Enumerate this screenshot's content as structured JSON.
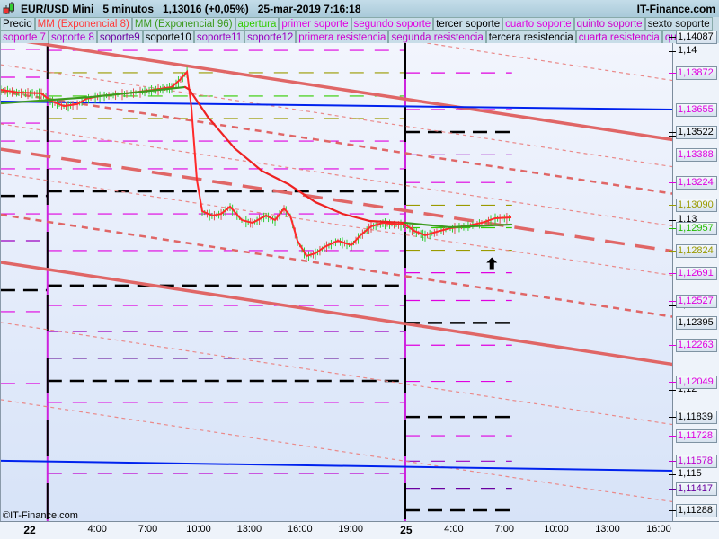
{
  "header": {
    "title": "EUR/USD Mini   5 minutos   1,13016 (+0,05%)   25-mar-2019 7:16:18",
    "brand": "IT-Finance.com",
    "copyright": "©IT-Finance.com"
  },
  "legend_row1": [
    {
      "label": "Precio",
      "color": "#000000"
    },
    {
      "label": "MM (Exponencial 8)",
      "color": "#ff3b3b"
    },
    {
      "label": "MM (Exponencial 96)",
      "color": "#3c9a1e"
    },
    {
      "label": "apertura",
      "color": "#33cc00"
    },
    {
      "label": "primer soporte",
      "color": "#e000e0"
    },
    {
      "label": "segundo soporte",
      "color": "#e000e0"
    },
    {
      "label": "tercer soporte",
      "color": "#000000"
    },
    {
      "label": "cuarto soporte",
      "color": "#e000e0"
    },
    {
      "label": "quinto soporte",
      "color": "#cc00cc"
    },
    {
      "label": "sexto soporte",
      "color": "#111111"
    }
  ],
  "legend_row2": [
    {
      "label": "soporte 7",
      "color": "#cc00cc"
    },
    {
      "label": "soporte 8",
      "color": "#b000d0"
    },
    {
      "label": "soporte9",
      "color": "#6a00a0"
    },
    {
      "label": "soporte10",
      "color": "#000000"
    },
    {
      "label": "soporte11",
      "color": "#9a00c0"
    },
    {
      "label": "soporte12",
      "color": "#9a00c0"
    },
    {
      "label": "primera resistencia",
      "color": "#d000d0"
    },
    {
      "label": "segunda resistencia",
      "color": "#c000c8"
    },
    {
      "label": "tercera resistencia",
      "color": "#000000"
    },
    {
      "label": "cuarta resistencia",
      "color": "#d000d0"
    },
    {
      "label": "quinta res",
      "color": "#c000c8"
    }
  ],
  "chart_data": {
    "type": "line",
    "title": "EUR/USD Mini 5 minutos",
    "ylim": [
      1.11085,
      1.14135
    ],
    "xlim_hours": [
      -1.76,
      38.03
    ],
    "x_ticks": [
      {
        "t": 0,
        "label": "22",
        "day": true
      },
      {
        "t": 4,
        "label": "4:00"
      },
      {
        "t": 7,
        "label": "7:00"
      },
      {
        "t": 10,
        "label": "10:00"
      },
      {
        "t": 13,
        "label": "13:00"
      },
      {
        "t": 16,
        "label": "16:00"
      },
      {
        "t": 19,
        "label": "19:00"
      },
      {
        "t": 22.28,
        "label": "25",
        "day": true
      },
      {
        "t": 25.1,
        "label": "4:00"
      },
      {
        "t": 28.1,
        "label": "7:00"
      },
      {
        "t": 31.17,
        "label": "10:00"
      },
      {
        "t": 34.2,
        "label": "13:00"
      },
      {
        "t": 37.23,
        "label": "16:00"
      }
    ],
    "y_plain_ticks": [
      {
        "v": 1.14,
        "label": "1,14"
      },
      {
        "v": 1.135,
        "label": "1,135"
      },
      {
        "v": 1.13,
        "label": "1,13"
      },
      {
        "v": 1.125,
        "label": "1,125"
      },
      {
        "v": 1.12,
        "label": "1,12"
      },
      {
        "v": 1.115,
        "label": "1,115"
      }
    ],
    "y_labels": [
      {
        "v": 1.14087,
        "label": "1,14087",
        "color": "#000000"
      },
      {
        "v": 1.13872,
        "label": "1,13872",
        "color": "#e000e0"
      },
      {
        "v": 1.13655,
        "label": "1,13655",
        "color": "#e000e0"
      },
      {
        "v": 1.13522,
        "label": "1,13522",
        "color": "#000000"
      },
      {
        "v": 1.13388,
        "label": "1,13388",
        "color": "#e000e0"
      },
      {
        "v": 1.13224,
        "label": "1,13224",
        "color": "#e000e0"
      },
      {
        "v": 1.1309,
        "label": "1,13090",
        "color": "#9a9a00"
      },
      {
        "v": 1.12957,
        "label": "1,12957",
        "color": "#22bb00"
      },
      {
        "v": 1.12824,
        "label": "1,12824",
        "color": "#9a9a00"
      },
      {
        "v": 1.12691,
        "label": "1,12691",
        "color": "#e000e0"
      },
      {
        "v": 1.12527,
        "label": "1,12527",
        "color": "#e000e0"
      },
      {
        "v": 1.12395,
        "label": "1,12395",
        "color": "#000000"
      },
      {
        "v": 1.12263,
        "label": "1,12263",
        "color": "#e000e0"
      },
      {
        "v": 1.12049,
        "label": "1,12049",
        "color": "#e000e0"
      },
      {
        "v": 1.11839,
        "label": "1,11839",
        "color": "#000000"
      },
      {
        "v": 1.11728,
        "label": "1,11728",
        "color": "#e000e0"
      },
      {
        "v": 1.11578,
        "label": "1,11578",
        "color": "#c000d0"
      },
      {
        "v": 1.11417,
        "label": "1,11417",
        "color": "#6a00a0"
      },
      {
        "v": 1.11288,
        "label": "1,11288",
        "color": "#000000"
      }
    ],
    "day_separators": [
      1.0,
      22.18
    ],
    "level_sets": [
      {
        "t0": -1.76,
        "t1": 1.0,
        "levels": [
          {
            "v": 1.14011,
            "c": "#e000e0"
          },
          {
            "v": 1.13846,
            "c": "#e000e0"
          },
          {
            "v": 1.13575,
            "c": "#e000e0"
          },
          {
            "v": 1.13469,
            "c": "#e000e0"
          },
          {
            "v": 1.13305,
            "c": "#e000e0"
          },
          {
            "v": 1.13145,
            "c": "#000000"
          },
          {
            "v": 1.13039,
            "c": "#e000e0"
          },
          {
            "v": 1.1288,
            "c": "#9a00c0"
          },
          {
            "v": 1.12588,
            "c": "#000000"
          },
          {
            "v": 1.12461,
            "c": "#e000e0"
          },
          {
            "v": 1.12036,
            "c": "#e000e0"
          }
        ]
      },
      {
        "t0": 1.0,
        "t1": 22.18,
        "levels": [
          {
            "v": 1.14005,
            "c": "#e000e0"
          },
          {
            "v": 1.13873,
            "c": "#9a9a00"
          },
          {
            "v": 1.13735,
            "c": "#33cc00"
          },
          {
            "v": 1.13602,
            "c": "#9a9a00"
          },
          {
            "v": 1.13469,
            "c": "#e000e0"
          },
          {
            "v": 1.13305,
            "c": "#e000e0"
          },
          {
            "v": 1.13172,
            "c": "#000000"
          },
          {
            "v": 1.13039,
            "c": "#e000e0"
          },
          {
            "v": 1.12822,
            "c": "#e000e0"
          },
          {
            "v": 1.12615,
            "c": "#000000"
          },
          {
            "v": 1.12498,
            "c": "#e000e0"
          },
          {
            "v": 1.12344,
            "c": "#9a00c0"
          },
          {
            "v": 1.12185,
            "c": "#5a0090"
          },
          {
            "v": 1.12052,
            "c": "#000000"
          },
          {
            "v": 1.11925,
            "c": "#e000e0"
          },
          {
            "v": 1.11505,
            "c": "#c000d0"
          }
        ]
      },
      {
        "t0": 22.18,
        "t1": 28.5,
        "levels": [
          {
            "v": 1.13872,
            "c": "#e000e0"
          },
          {
            "v": 1.13655,
            "c": "#e000e0"
          },
          {
            "v": 1.13522,
            "c": "#000000"
          },
          {
            "v": 1.13388,
            "c": "#9a00c0"
          },
          {
            "v": 1.13224,
            "c": "#e000e0"
          },
          {
            "v": 1.1309,
            "c": "#9a9a00"
          },
          {
            "v": 1.12957,
            "c": "#33cc00"
          },
          {
            "v": 1.12824,
            "c": "#9a9a00"
          },
          {
            "v": 1.12691,
            "c": "#e000e0"
          },
          {
            "v": 1.12527,
            "c": "#e000e0"
          },
          {
            "v": 1.12395,
            "c": "#000000"
          },
          {
            "v": 1.12263,
            "c": "#e000e0"
          },
          {
            "v": 1.12049,
            "c": "#e000e0"
          },
          {
            "v": 1.11839,
            "c": "#000000"
          },
          {
            "v": 1.11728,
            "c": "#e000e0"
          },
          {
            "v": 1.11578,
            "c": "#9a00c0"
          },
          {
            "v": 1.11417,
            "c": "#6a00a0"
          },
          {
            "v": 1.11288,
            "c": "#000000"
          }
        ]
      }
    ],
    "trendlines": [
      {
        "name": "channel-top",
        "style": "thick",
        "p": [
          -1.76,
          1.1408,
          38.14,
          1.13475
        ]
      },
      {
        "name": "thin-a",
        "style": "thin",
        "p": [
          -1.76,
          1.1443,
          38.14,
          1.13825
        ]
      },
      {
        "name": "thin-b",
        "style": "thin",
        "p": [
          -1.76,
          1.1392,
          38.14,
          1.13315
        ]
      },
      {
        "name": "medium-c",
        "style": "medium",
        "p": [
          -1.76,
          1.13761,
          38.14,
          1.13156
        ]
      },
      {
        "name": "thin-d",
        "style": "thin",
        "p": [
          -1.76,
          1.1357,
          38.14,
          1.12965
        ]
      },
      {
        "name": "channel-mid",
        "style": "thickdash",
        "p": [
          -1.76,
          1.13421,
          38.14,
          1.12816
        ]
      },
      {
        "name": "thin-f",
        "style": "thin",
        "p": [
          -1.76,
          1.13278,
          38.14,
          1.12673
        ]
      },
      {
        "name": "medium-g",
        "style": "medium",
        "p": [
          -1.76,
          1.13034,
          38.14,
          1.12429
        ]
      },
      {
        "name": "channel-bottom",
        "style": "thick",
        "p": [
          -1.76,
          1.12753,
          38.14,
          1.12148
        ]
      },
      {
        "name": "thin-i",
        "style": "thin",
        "p": [
          -1.76,
          1.12397,
          38.14,
          1.11792
        ]
      },
      {
        "name": "thin-j",
        "style": "thin",
        "p": [
          -1.76,
          1.11941,
          38.14,
          1.11336
        ]
      },
      {
        "name": "blue-upper",
        "style": "blue",
        "p": [
          -1.76,
          1.13703,
          38.14,
          1.13655
        ]
      },
      {
        "name": "blue-lower",
        "style": "blue",
        "p": [
          -1.76,
          1.1158,
          38.14,
          1.11521
        ]
      }
    ],
    "price": [
      [
        -1.76,
        1.13772
      ],
      [
        -0.69,
        1.13756
      ],
      [
        0.64,
        1.13751
      ],
      [
        1.17,
        1.13708
      ],
      [
        1.97,
        1.13676
      ],
      [
        2.77,
        1.13687
      ],
      [
        3.3,
        1.13719
      ],
      [
        4.1,
        1.13735
      ],
      [
        5.69,
        1.13751
      ],
      [
        7.29,
        1.13772
      ],
      [
        8.35,
        1.13788
      ],
      [
        8.88,
        1.13835
      ],
      [
        9.26,
        1.13878
      ],
      [
        9.52,
        1.13666
      ],
      [
        9.84,
        1.13241
      ],
      [
        10.16,
        1.13055
      ],
      [
        10.74,
        1.13029
      ],
      [
        11.28,
        1.13039
      ],
      [
        11.81,
        1.13082
      ],
      [
        12.5,
        1.13002
      ],
      [
        13.14,
        1.12986
      ],
      [
        13.94,
        1.13029
      ],
      [
        14.47,
        1.13002
      ],
      [
        15.0,
        1.13071
      ],
      [
        15.37,
        1.13029
      ],
      [
        15.8,
        1.1288
      ],
      [
        16.33,
        1.1279
      ],
      [
        16.86,
        1.12806
      ],
      [
        17.39,
        1.12843
      ],
      [
        18.19,
        1.1288
      ],
      [
        18.99,
        1.12854
      ],
      [
        19.52,
        1.12912
      ],
      [
        20.16,
        1.12965
      ],
      [
        20.85,
        1.12986
      ],
      [
        21.65,
        1.12976
      ],
      [
        22.18,
        1.12976
      ],
      [
        22.71,
        1.12938
      ],
      [
        23.35,
        1.12912
      ],
      [
        24.04,
        1.12933
      ],
      [
        24.84,
        1.12954
      ],
      [
        25.9,
        1.1297
      ],
      [
        26.7,
        1.12986
      ],
      [
        27.5,
        1.13013
      ],
      [
        28.46,
        1.13018
      ]
    ],
    "ema96": [
      [
        -1.76,
        1.13692,
        "g"
      ],
      [
        3.56,
        1.13729,
        "g"
      ],
      [
        9.15,
        1.13788,
        "g"
      ],
      [
        9.41,
        1.13772,
        "r"
      ],
      [
        10.48,
        1.13613,
        "r"
      ],
      [
        12.07,
        1.13427,
        "r"
      ],
      [
        13.67,
        1.13294,
        "r"
      ],
      [
        15.27,
        1.13214,
        "r"
      ],
      [
        16.86,
        1.13108,
        "r"
      ],
      [
        18.46,
        1.13039,
        "r"
      ],
      [
        20.05,
        1.12997,
        "r"
      ],
      [
        22.18,
        1.12986,
        "r"
      ],
      [
        24.84,
        1.1296,
        "g"
      ],
      [
        28.46,
        1.12976,
        "g"
      ]
    ],
    "marker": {
      "type": "up-arrow",
      "t": 27.3,
      "v": 1.12745
    }
  }
}
